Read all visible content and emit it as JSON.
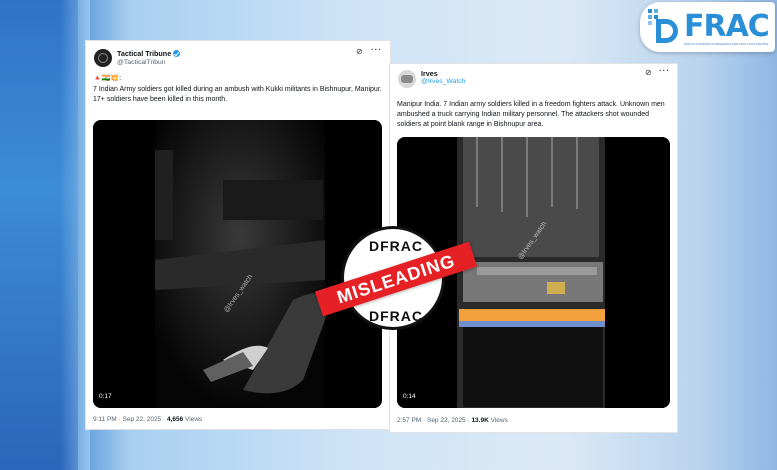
{
  "logo": {
    "text": "FRAC",
    "mark_text": "D",
    "sub": "DIGITAL FORENSICS RESEARCH AND ANALYTICS CENTRE"
  },
  "tweet1": {
    "name": "Tactical Tribune",
    "handle": "@TacticalTribun",
    "flags": "🔺🇮🇳💥:",
    "body": "7 Indian Army soldiers got killed during an ambush with Kukki militants in Bishnupur, Manipur. 17+ soldiers have been killed in this month.",
    "video_duration": "0:17",
    "watermark": "@Irves_watch",
    "time": "9:11 PM · Sep 22, 2025 · ",
    "views_count": "4,656",
    "views_label": " Views"
  },
  "tweet2": {
    "name": "Irves",
    "handle": "@Irves_Watch",
    "body": "Manipur India. 7 Indian army soldiers killed in a freedom fighters attack. Unknown men ambushed a truck carrying Indian military personnel. The attackers shot wounded soldiers at point blank range in Bishnupur area.",
    "video_duration": "0:14",
    "watermark": "@Irves_watch",
    "time": "2:57 PM · Sep 22, 2025 · ",
    "views_count": "13.9K",
    "views_label": " Views"
  },
  "stamp": {
    "top": "DFRAC",
    "banner": "MISLEADING",
    "bottom": "DFRAC"
  },
  "icons": {
    "grok": "grok-icon",
    "more": "more-options-icon",
    "verified": "verified-badge-icon"
  },
  "colors": {
    "verified": "#1d9bf0",
    "stamp_red": "#e62125",
    "logo_blue": "#2a8fd6"
  }
}
